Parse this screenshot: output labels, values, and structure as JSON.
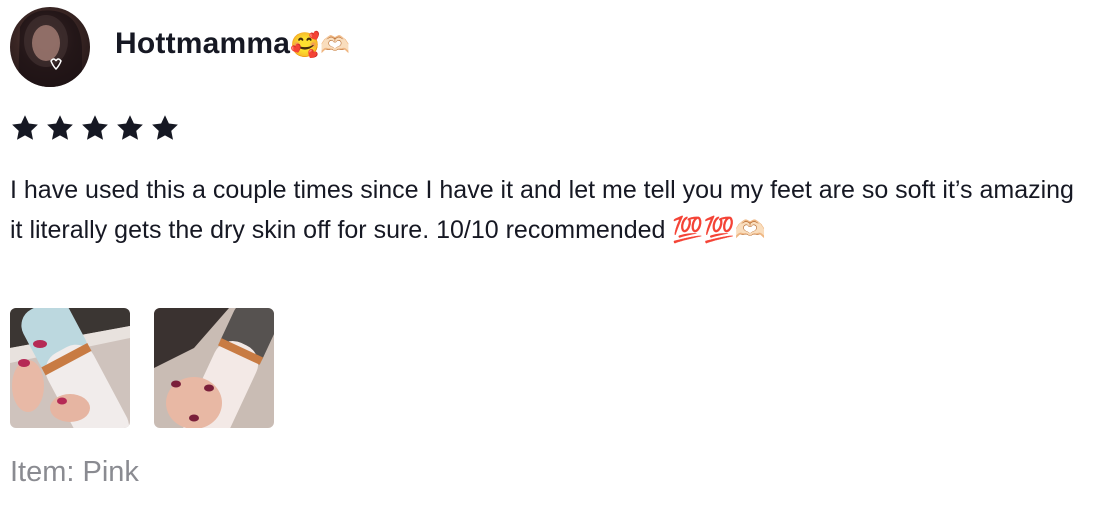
{
  "review": {
    "username": "Hottmamma",
    "username_emojis": "🥰🫶🏻",
    "rating": 5,
    "body": "I have used this a couple times since I have it and let me tell you my feet are so soft it’s amazing it literally gets the dry skin off for sure. 10/10 recommended 💯💯🫶🏻",
    "photos": [
      {
        "icon": "product-photo-1"
      },
      {
        "icon": "product-photo-2"
      }
    ],
    "item_variant": "Item: Pink"
  },
  "colors": {
    "star": "#161823",
    "muted_text": "#8a8b91"
  }
}
